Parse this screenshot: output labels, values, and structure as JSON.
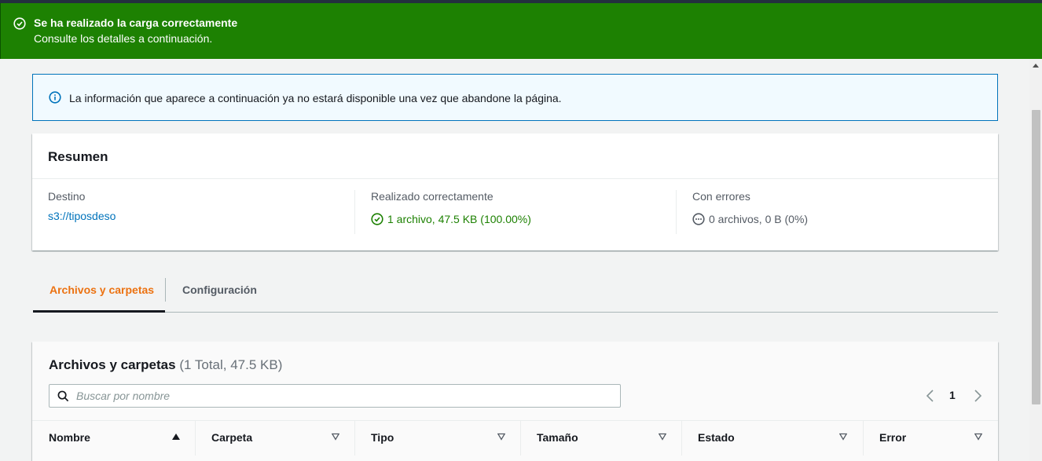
{
  "flash": {
    "title": "Se ha realizado la carga correctamente",
    "subtitle": "Consulte los detalles a continuación.",
    "color": "#1d8102"
  },
  "info_alert": {
    "text": "La información que aparece a continuación ya no estará disponible una vez que abandone la página."
  },
  "summary": {
    "title": "Resumen",
    "destination_label": "Destino",
    "destination_value": "s3://tiposdeso",
    "success_label": "Realizado correctamente",
    "success_value": "1 archivo, 47.5 KB (100.00%)",
    "errors_label": "Con errores",
    "errors_value": "0 archivos, 0 B (0%)"
  },
  "tabs": [
    {
      "label": "Archivos y carpetas",
      "active": true
    },
    {
      "label": "Configuración",
      "active": false
    }
  ],
  "files_panel": {
    "title": "Archivos y carpetas",
    "count": "(1 Total, 47.5 KB)",
    "search_placeholder": "Buscar por nombre",
    "page": "1",
    "columns": [
      "Nombre",
      "Carpeta",
      "Tipo",
      "Tamaño",
      "Estado",
      "Error"
    ]
  },
  "colors": {
    "accent": "#ec7211",
    "link": "#0073bb",
    "success": "#1d8102"
  }
}
